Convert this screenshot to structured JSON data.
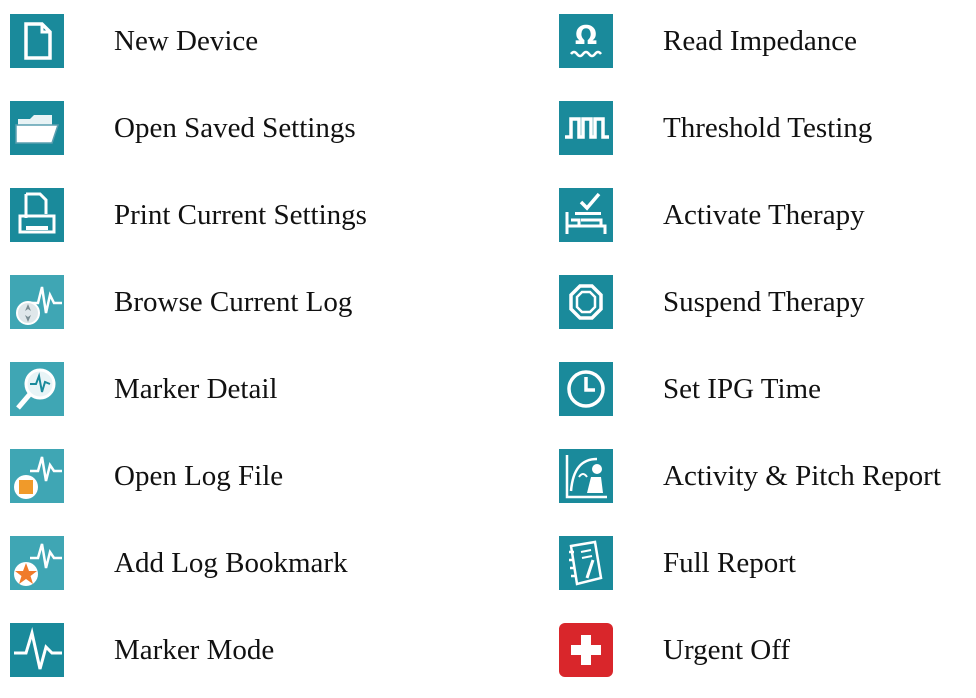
{
  "colors": {
    "teal": "#1a8a9b",
    "teal_light": "#3fa6b4",
    "orange": "#f09a2a",
    "red": "#d9262b"
  },
  "left_items": [
    {
      "label": "New Device",
      "icon": "new-device-icon"
    },
    {
      "label": "Open Saved Settings",
      "icon": "open-folder-icon"
    },
    {
      "label": "Print Current Settings",
      "icon": "print-icon"
    },
    {
      "label": "Browse Current Log",
      "icon": "browse-log-icon"
    },
    {
      "label": "Marker Detail",
      "icon": "marker-detail-icon"
    },
    {
      "label": "Open Log File",
      "icon": "open-log-file-icon"
    },
    {
      "label": "Add Log Bookmark",
      "icon": "add-bookmark-icon"
    },
    {
      "label": "Marker Mode",
      "icon": "marker-mode-icon"
    }
  ],
  "right_items": [
    {
      "label": "Read Impedance",
      "icon": "impedance-icon"
    },
    {
      "label": "Threshold Testing",
      "icon": "threshold-icon"
    },
    {
      "label": "Activate Therapy",
      "icon": "activate-therapy-icon"
    },
    {
      "label": "Suspend Therapy",
      "icon": "suspend-therapy-icon"
    },
    {
      "label": "Set IPG Time",
      "icon": "clock-icon"
    },
    {
      "label": "Activity & Pitch Report",
      "icon": "activity-report-icon"
    },
    {
      "label": "Full Report",
      "icon": "full-report-icon"
    },
    {
      "label": "Urgent Off",
      "icon": "urgent-off-icon"
    }
  ]
}
